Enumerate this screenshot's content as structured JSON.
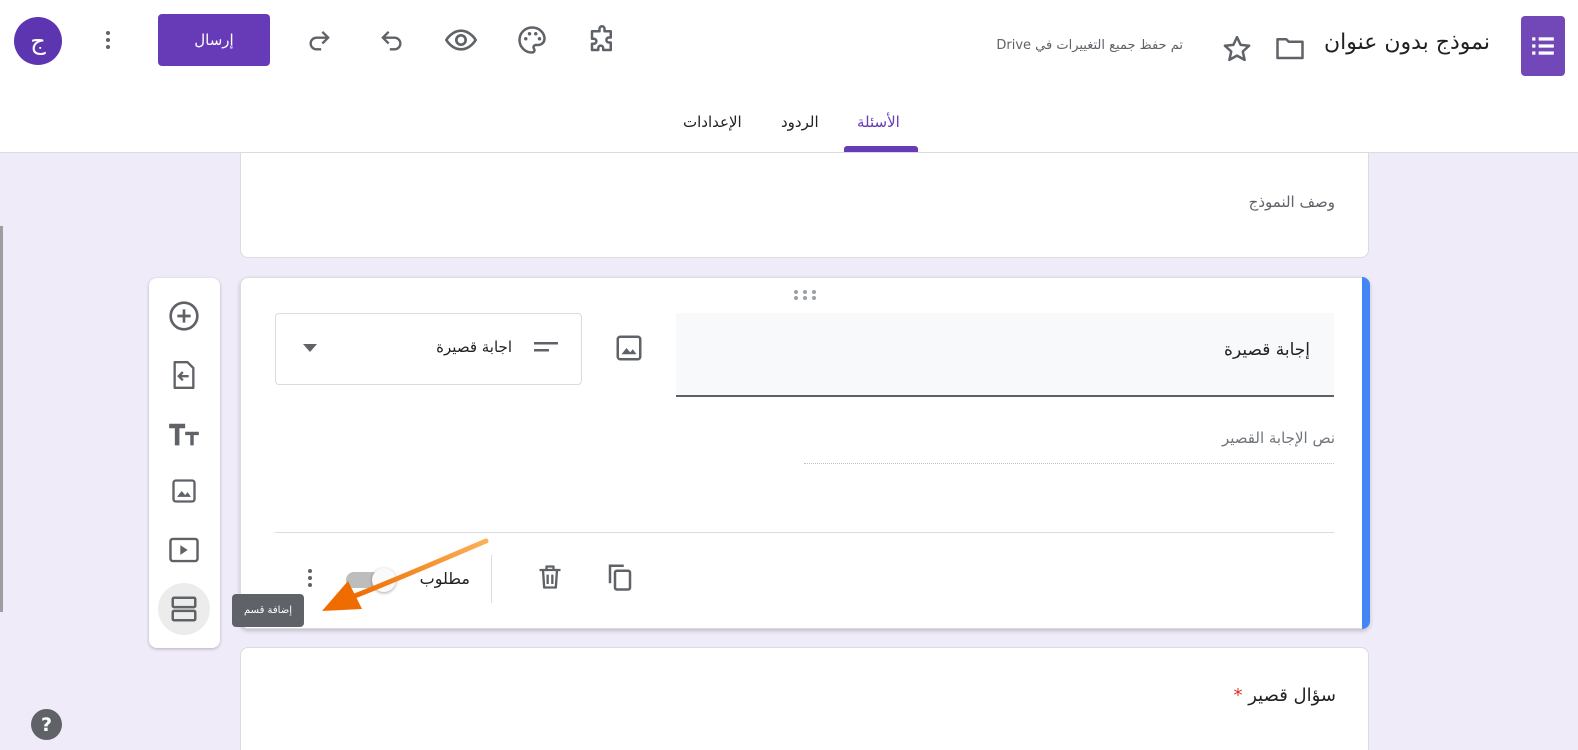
{
  "header": {
    "avatar_letter": "ج",
    "send_label": "إرسال",
    "saved_status": "تم حفظ جميع التغييرات في Drive",
    "form_title": "نموذج بدون عنوان",
    "icons": [
      "more-vert-icon",
      "redo-icon",
      "undo-icon",
      "preview-eye-icon",
      "palette-icon",
      "addon-puzzle-icon",
      "star-icon",
      "folder-icon",
      "forms-logo-icon"
    ]
  },
  "tabs": [
    {
      "label": "الأسئلة",
      "active": true
    },
    {
      "label": "الردود",
      "active": false
    },
    {
      "label": "الإعدادات",
      "active": false
    }
  ],
  "form_header": {
    "description_placeholder": "وصف النموذج"
  },
  "question": {
    "title": "إجابة قصيرة",
    "type_label": "اجابة قصيرة",
    "answer_placeholder": "نص الإجابة القصير",
    "required_label": "مطلوب",
    "required_on": false
  },
  "toolbar": {
    "items": [
      "add-question-icon",
      "import-questions-icon",
      "add-title-icon",
      "add-image-icon",
      "add-video-icon",
      "add-section-icon"
    ]
  },
  "tooltip": "إضافة قسم",
  "next_question": {
    "title": "سؤال قصير",
    "required_marker": "*"
  },
  "colors": {
    "brand": "#673ab7",
    "accent_blue": "#4285f4",
    "canvas": "#f0ebf8",
    "arrow": "#f57c00"
  }
}
